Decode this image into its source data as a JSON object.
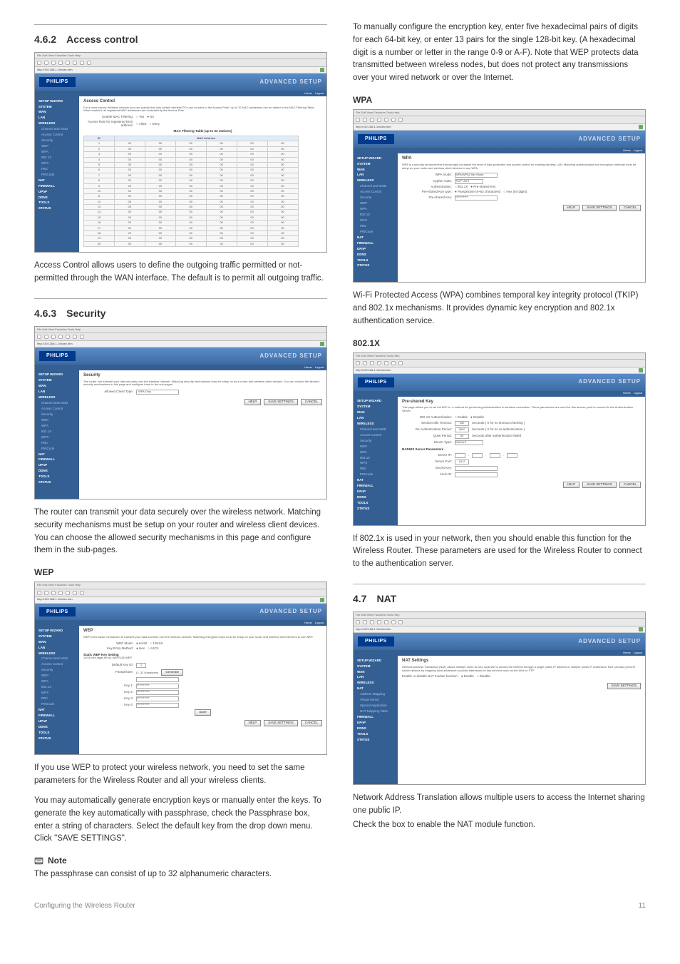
{
  "footer": {
    "left": "Configuring the Wireless Router",
    "page": "11"
  },
  "common": {
    "logo": "PHILIPS",
    "adv": "ADVANCED SETUP",
    "homebar_items": [
      "Home",
      "Logout"
    ],
    "browser_menu": "File   Edit   View   Favorites   Tools   Help",
    "addr": "http://192.168.1.1/index.htm",
    "buttons": {
      "help": "HELP",
      "save": "SAVE SETTINGS",
      "cancel": "CANCEL",
      "save_short": "Save"
    }
  },
  "sidenav": {
    "main": [
      "SETUP WIZARD",
      "SYSTEM",
      "WAN",
      "LAN",
      "WIRELESS",
      "NAT",
      "FIREWALL",
      "UPnP",
      "DDNS",
      "TOOLS",
      "STATUS"
    ],
    "wireless_sub": [
      "Channel and SSID",
      "Access Control",
      "Security",
      "WEP",
      "WPA",
      "802.1X",
      "WPS",
      "PBC",
      "PINCode"
    ],
    "nat_sub": [
      "Address Mapping",
      "Virtual Server",
      "Special Application",
      "NAT Mapping Table"
    ]
  },
  "left": {
    "s462": {
      "heading_num": "4.6.2",
      "heading": "Access control",
      "page_title": "Access Control",
      "page_desc": "For a more secure Wireless network you can specify that only certain wireless PCs can connect to the Access Point. Up to 32 MAC addresses can be added to the MAC Filtering Table. When enabled, all registered MAC addresses are controlled by the Access Rule.",
      "enable_label": "Enable MAC Filtering:",
      "access_rule": "Access Rule for registered MAC address:",
      "yes": "Yes",
      "no": "No",
      "allow": "Allow",
      "deny": "Deny",
      "table_title": "MAC Filtering Table (up to 32 stations)",
      "th_id": "ID",
      "th_mac": "MAC Address",
      "caption": "Access Control allows users to define the outgoing traffic permitted or not-permitted through the WAN interface. The default is to permit all outgoing traffic."
    },
    "s463": {
      "heading_num": "4.6.3",
      "heading": "Security",
      "page_title": "Security",
      "page_desc": "The router can transmit your data securely over the wireless network. Matching security mechanisms must be setup on your router and wireless client devices. You can choose the allowed security mechanisms in this page and configure them in the sub-pages.",
      "allowed_label": "Allowed Client Type:",
      "allowed_val": "WPA Only",
      "caption": "The router can transmit your data securely over the wireless network. Matching security mechanisms must be setup on your router and wireless client devices. You can choose the allowed security mechanisms in this page and configure them in the sub-pages."
    },
    "wep": {
      "label": "WEP",
      "page_title": "WEP",
      "page_desc": "WEP is the basic mechanism to transmit your data securely over the wireless network. Matching encryption keys must be setup on your router and wireless client devices to use WEP.",
      "wep_mode": "WEP Mode:",
      "m64": "64-bit",
      "m128": "128-bit",
      "key_entry": "Key Entry Method:",
      "hex": "Hex",
      "ascii": "ASCII",
      "static_section": "Static WEP Key Setting",
      "static_hint": "10/26 hex digits for 64-WEP/128-WEP",
      "default_key": "Default Key ID:",
      "default_val": "1",
      "passphrase": "Passphrase:",
      "chars": "(1–32 characters)",
      "gen": "Generate",
      "key1": "Key 1:",
      "key2": "Key 2:",
      "key3": "Key 3:",
      "key4": "Key 4:",
      "caption1": "If you use WEP to protect your wireless network, you need to set the same parameters for the  Wireless Router and all your wireless clients.",
      "caption2": "You may automatically generate encryption keys or manually enter the keys. To generate the key automatically with passphrase, check the Passphrase box, enter a string of characters. Select the default key from the drop down menu. Click \"SAVE SETTINGS\".",
      "note_label": "Note",
      "note_text": "The passphrase can consist of up to 32 alphanumeric characters."
    }
  },
  "right": {
    "intro": "To manually configure the encryption key, enter five hexadecimal pairs of digits for each 64-bit key, or enter 13 pairs for the single 128-bit key. (A hexadecimal digit is a number or letter in the range 0-9 or A-F). Note that WEP protects data transmitted between wireless nodes, but does not protect any transmissions over your wired network or over the Internet.",
    "wpa": {
      "label": "WPA",
      "page_title": "WPA",
      "page_desc": "WPA is a security enhancement that strongly increases the level of data protection and access control for existing wireless LAN. Matching authentication and encryption methods must be setup on your router and wireless client devices to use WPA.",
      "wpa_mode": "WPA mode:",
      "wpa_val": "WPA/WPA2 Mix Mode",
      "cypher": "Cypher suite:",
      "cypher_val": "TKIP+AES",
      "auth": "Authentication:",
      "a1": "802.1X",
      "a2": "Pre-shared Key",
      "psktype": "Pre-shared Key type:",
      "pt1": "Passphrase (8~63 characters)",
      "pt2": "Hex (64 digits)",
      "psk": "Pre-shared Key:",
      "caption": "Wi-Fi Protected Access (WPA) combines temporal key integrity protocol (TKIP) and 802.1x mechanisms. It provides dynamic key encryption and 802.1x authentication service."
    },
    "s8021x": {
      "label": "802.1X",
      "page_title": "Pre-shared Key",
      "page_desc": "This page allows you to set the 802.1x, a method for performing authentication to wireless connection. These parameters are used for this access point to connect to the Authentication Server.",
      "auth": "802.1X Authentication:",
      "en": "Enable",
      "dis": "Disable",
      "sess": "Session Idle Timeout:",
      "sess_val": "300",
      "sess_unit": "Seconds ( 0 for no timeout checking )",
      "reauth": "Re-Authentication Period:",
      "reauth_val": "3600",
      "reauth_unit": "Seconds ( 0 for no re-authentication )",
      "quiet": "Quiet Period:",
      "quiet_val": "60",
      "quiet_unit": "Seconds after authentication failed",
      "stype": "Server Type:",
      "stype_val": "RADIUS",
      "rad_section": "RADIUS Server Parameters",
      "sip": "Server IP:",
      "sport": "Server Port:",
      "sport_val": "1812",
      "skey": "Secret Key:",
      "nas": "NAS-ID:",
      "caption": "If 802.1x is used in your network, then you should enable this function for the Wireless Router. These parameters are used for the Wireless Router to connect to the authentication server."
    },
    "s47": {
      "heading_num": "4.7",
      "heading": "NAT",
      "page_title": "NAT Settings",
      "page_desc": "Network Address Translation (NAT) allows multiple users at your local site to access the Internet through a single public IP address or multiple public IP addresses. NAT can also prevent hacker attacks by mapping local addresses to public addresses for key services such as the Web or FTP.",
      "enable_label": "Enable or disable NAT module function:",
      "en": "Enable",
      "dis": "Disable",
      "caption1": "Network Address Translation allows multiple users to access the Internet sharing one public IP.",
      "caption2": "Check the box to enable the NAT module function."
    }
  }
}
